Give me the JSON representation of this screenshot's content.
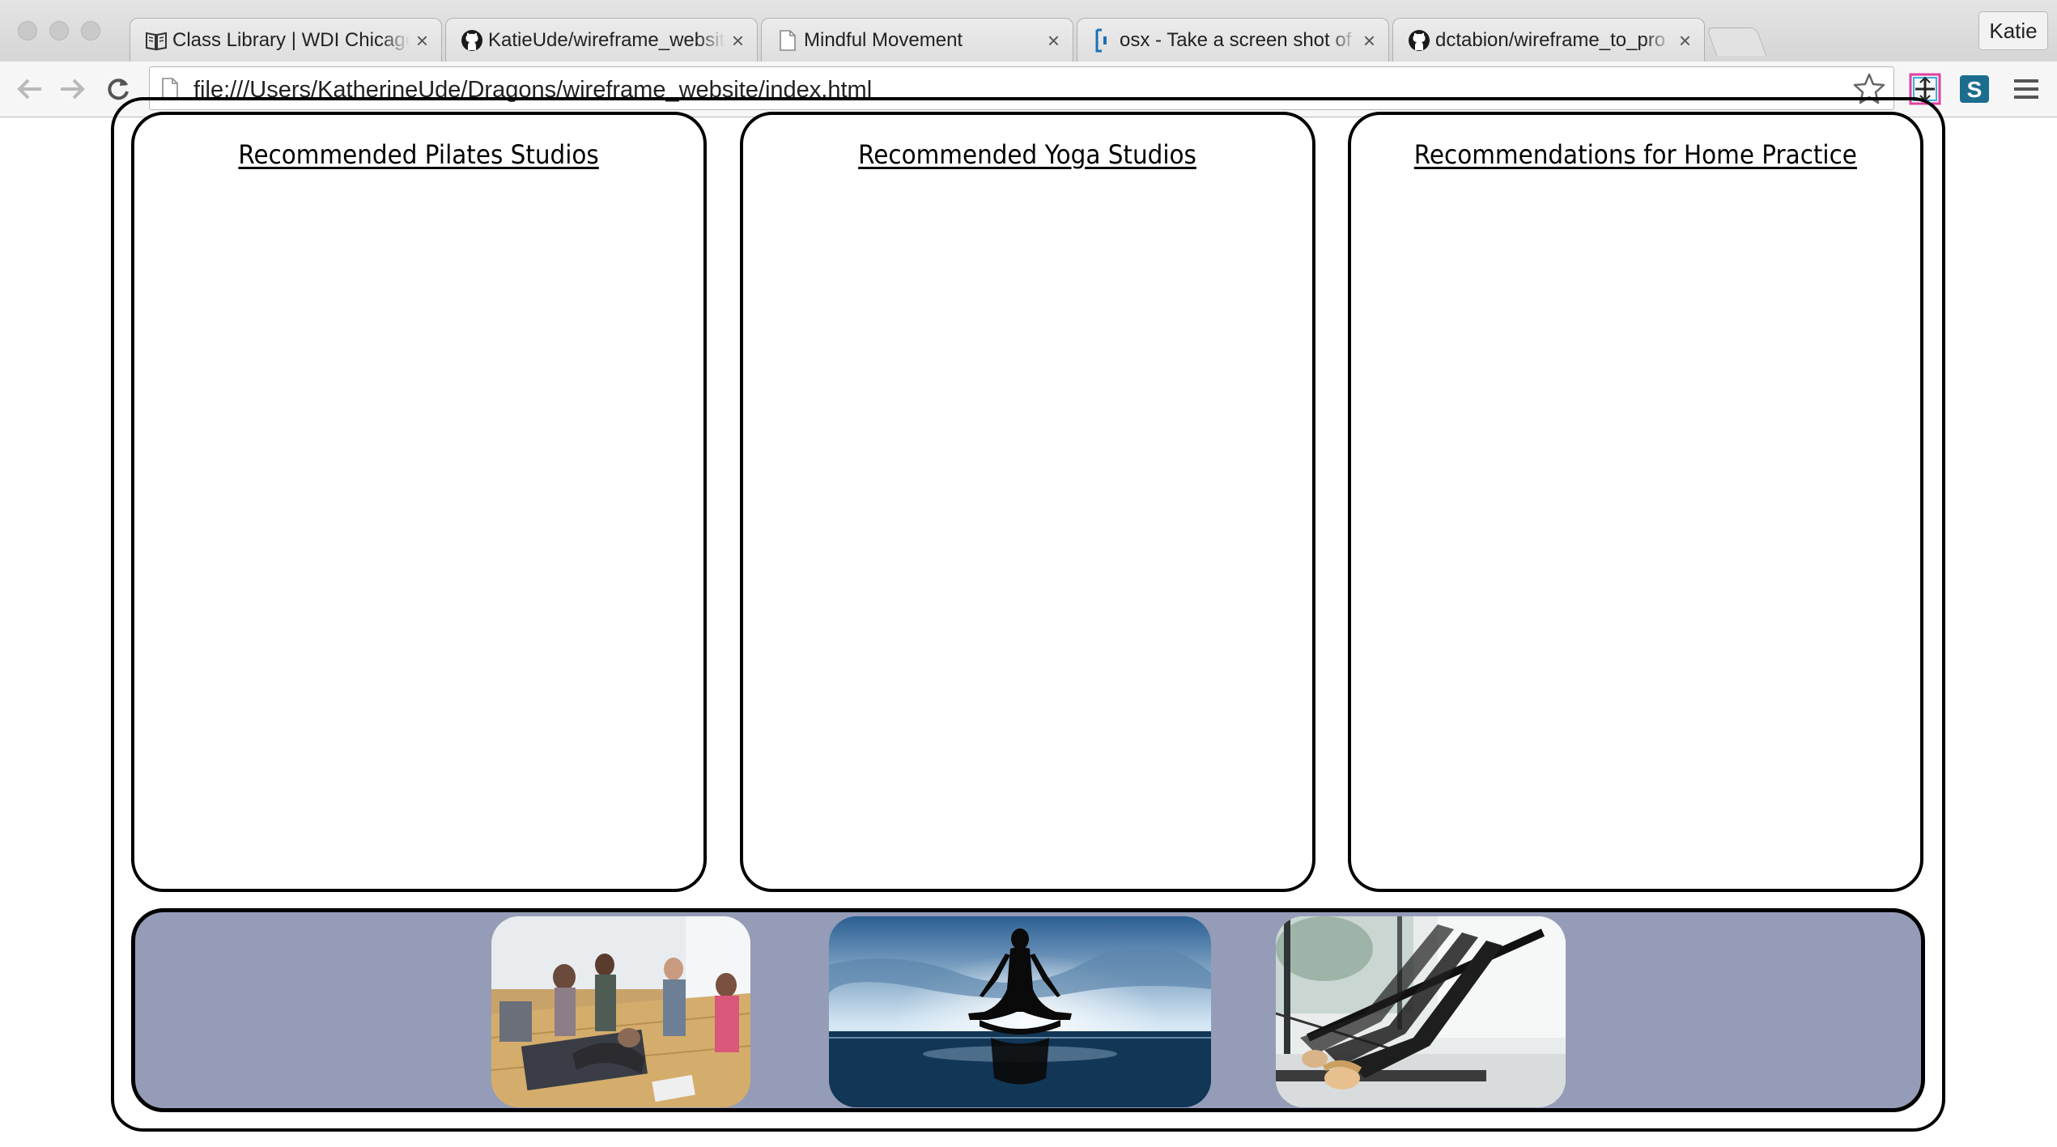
{
  "browser": {
    "tabs": [
      {
        "title": "Class Library | WDI Chicago",
        "icon": "book-icon"
      },
      {
        "title": "KatieUde/wireframe_website",
        "icon": "github-icon"
      },
      {
        "title": "Mindful Movement",
        "icon": "page-icon",
        "active": true
      },
      {
        "title": "osx - Take a screen shot of",
        "icon": "stackexchange-icon"
      },
      {
        "title": "dctabion/wireframe_to_pro",
        "icon": "github-icon"
      }
    ],
    "profile_name": "Katie",
    "url": "file:///Users/KatherineUde/Dragons/wireframe_website/index.html"
  },
  "page": {
    "cards": [
      {
        "title": "Recommended Pilates Studios"
      },
      {
        "title": "Recommended Yoga Studios"
      },
      {
        "title": "Recommendations for Home Practice"
      }
    ],
    "gallery": {
      "background_color": "#959cb7",
      "photos": [
        {
          "subject": "group yoga class photo"
        },
        {
          "subject": "meditation silhouette at sea photo"
        },
        {
          "subject": "pilates reformer class photo"
        }
      ]
    }
  }
}
